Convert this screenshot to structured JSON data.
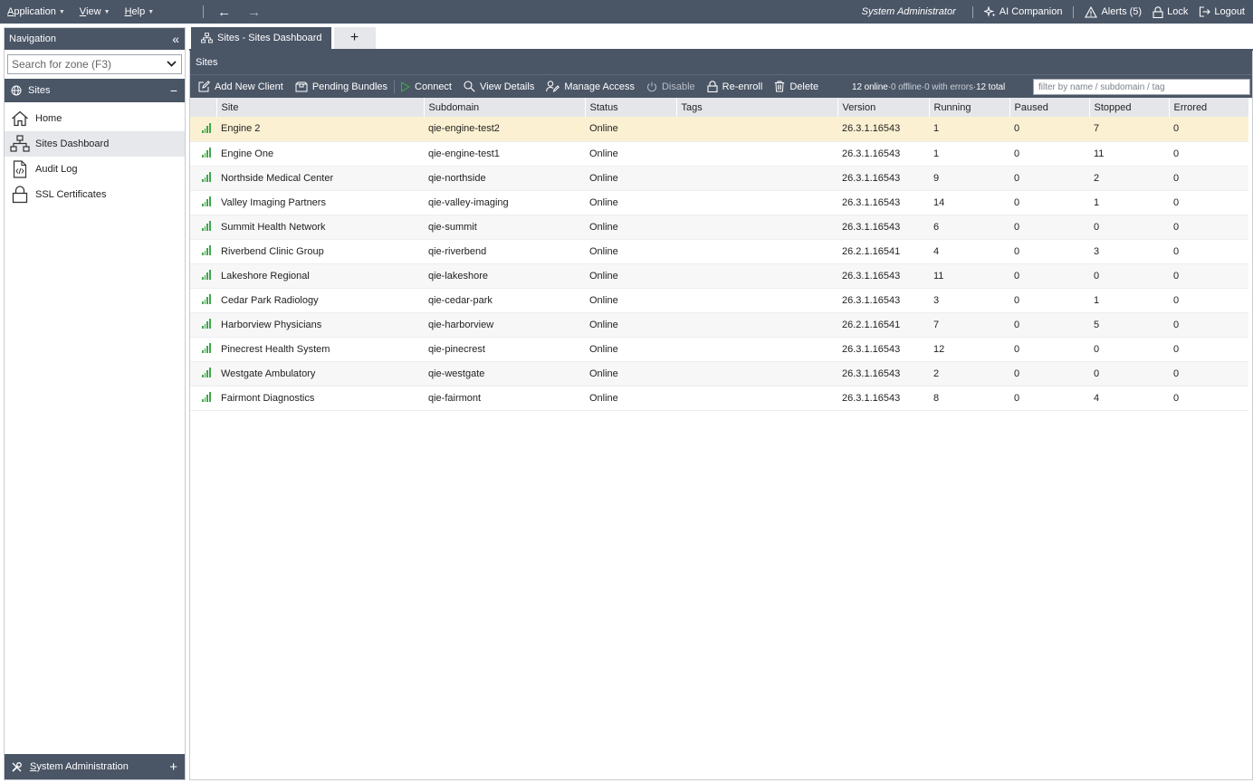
{
  "menu": {
    "application_mnemonic": "A",
    "application_rest": "pplication",
    "view_mnemonic": "V",
    "view_rest": "iew",
    "help_mnemonic": "H",
    "help_rest": "elp"
  },
  "header": {
    "user_role": "System Administrator",
    "ai_companion": "AI Companion",
    "alerts": "Alerts (5)",
    "lock": "Lock",
    "logout": "Logout"
  },
  "nav": {
    "title": "Navigation",
    "collapse_glyph": "«",
    "search_placeholder": "Search for zone (F3)",
    "section": "Sites",
    "section_toggle": "−",
    "items": [
      {
        "label": "Home",
        "icon": "home-icon"
      },
      {
        "label": "Sites Dashboard",
        "icon": "sitemap-icon"
      },
      {
        "label": "Audit Log",
        "icon": "code-file-icon"
      },
      {
        "label": "SSL Certificates",
        "icon": "lock-icon"
      }
    ],
    "bottom_mnemonic": "S",
    "bottom_rest": "ystem Administration",
    "bottom_toggle": "+"
  },
  "tabs": {
    "active": "Sites - Sites Dashboard",
    "add_glyph": "+"
  },
  "pane": {
    "title": "Sites"
  },
  "toolbar": {
    "add_new_client": "Add New Client",
    "pending_bundles": "Pending Bundles",
    "connect": "Connect",
    "view_details": "View Details",
    "manage_access": "Manage Access",
    "disable": "Disable",
    "re_enroll": "Re-enroll",
    "delete": "Delete",
    "counts_online": "12 online",
    "counts_sep1": " · ",
    "counts_offline": "0 offline",
    "counts_sep2": " · ",
    "counts_errors": "0 with errors",
    "counts_sep3": " · ",
    "counts_total": "12 total",
    "filter_placeholder": "filter by name / subdomain / tag"
  },
  "table": {
    "columns": [
      "Site",
      "Subdomain",
      "Status",
      "Tags",
      "Version",
      "Running",
      "Paused",
      "Stopped",
      "Errored"
    ],
    "rows": [
      {
        "site": "Engine 2",
        "subdomain": "qie-engine-test2",
        "status": "Online",
        "tags": "",
        "version": "26.3.1.16543",
        "running": "1",
        "paused": "0",
        "stopped": "7",
        "errored": "0"
      },
      {
        "site": "Engine One",
        "subdomain": "qie-engine-test1",
        "status": "Online",
        "tags": "",
        "version": "26.3.1.16543",
        "running": "1",
        "paused": "0",
        "stopped": "11",
        "errored": "0"
      },
      {
        "site": "Northside Medical Center",
        "subdomain": "qie-northside",
        "status": "Online",
        "tags": "",
        "version": "26.3.1.16543",
        "running": "9",
        "paused": "0",
        "stopped": "2",
        "errored": "0"
      },
      {
        "site": "Valley Imaging Partners",
        "subdomain": "qie-valley-imaging",
        "status": "Online",
        "tags": "",
        "version": "26.3.1.16543",
        "running": "14",
        "paused": "0",
        "stopped": "1",
        "errored": "0"
      },
      {
        "site": "Summit Health Network",
        "subdomain": "qie-summit",
        "status": "Online",
        "tags": "",
        "version": "26.3.1.16543",
        "running": "6",
        "paused": "0",
        "stopped": "0",
        "errored": "0"
      },
      {
        "site": "Riverbend Clinic Group",
        "subdomain": "qie-riverbend",
        "status": "Online",
        "tags": "",
        "version": "26.2.1.16541",
        "running": "4",
        "paused": "0",
        "stopped": "3",
        "errored": "0"
      },
      {
        "site": "Lakeshore Regional",
        "subdomain": "qie-lakeshore",
        "status": "Online",
        "tags": "",
        "version": "26.3.1.16543",
        "running": "11",
        "paused": "0",
        "stopped": "0",
        "errored": "0"
      },
      {
        "site": "Cedar Park Radiology",
        "subdomain": "qie-cedar-park",
        "status": "Online",
        "tags": "",
        "version": "26.3.1.16543",
        "running": "3",
        "paused": "0",
        "stopped": "1",
        "errored": "0"
      },
      {
        "site": "Harborview Physicians",
        "subdomain": "qie-harborview",
        "status": "Online",
        "tags": "",
        "version": "26.2.1.16541",
        "running": "7",
        "paused": "0",
        "stopped": "5",
        "errored": "0"
      },
      {
        "site": "Pinecrest Health System",
        "subdomain": "qie-pinecrest",
        "status": "Online",
        "tags": "",
        "version": "26.3.1.16543",
        "running": "12",
        "paused": "0",
        "stopped": "0",
        "errored": "0"
      },
      {
        "site": "Westgate Ambulatory",
        "subdomain": "qie-westgate",
        "status": "Online",
        "tags": "",
        "version": "26.3.1.16543",
        "running": "2",
        "paused": "0",
        "stopped": "0",
        "errored": "0"
      },
      {
        "site": "Fairmont Diagnostics",
        "subdomain": "qie-fairmont",
        "status": "Online",
        "tags": "",
        "version": "26.3.1.16543",
        "running": "8",
        "paused": "0",
        "stopped": "4",
        "errored": "0"
      }
    ]
  },
  "colors": {
    "chrome": "#4a5566",
    "selected_row": "#fbf1d2",
    "signal_green": "#3ea84a"
  }
}
